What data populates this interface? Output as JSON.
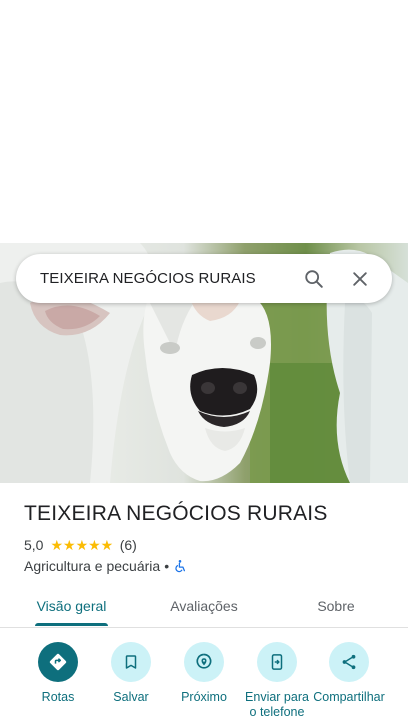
{
  "search": {
    "query": "TEIXEIRA NEGÓCIOS RURAIS"
  },
  "place": {
    "name": "TEIXEIRA NEGÓCIOS RURAIS",
    "rating": "5,0",
    "stars": "★★★★★",
    "review_count": "(6)",
    "category": "Agricultura e pecuária",
    "separator": "•"
  },
  "tabs": [
    {
      "label": "Visão geral",
      "active": true
    },
    {
      "label": "Avaliações",
      "active": false
    },
    {
      "label": "Sobre",
      "active": false
    }
  ],
  "actions": [
    {
      "label": "Rotas",
      "icon": "directions-icon"
    },
    {
      "label": "Salvar",
      "icon": "bookmark-icon"
    },
    {
      "label": "Próximo",
      "icon": "nearby-icon"
    },
    {
      "label": "Enviar para o telefone",
      "icon": "send-to-phone-icon"
    },
    {
      "label": "Compartilhar",
      "icon": "share-icon"
    }
  ],
  "colors": {
    "accent": "#0e6f7d",
    "action_bg": "#ccf2f7",
    "star": "#fbbc04"
  }
}
